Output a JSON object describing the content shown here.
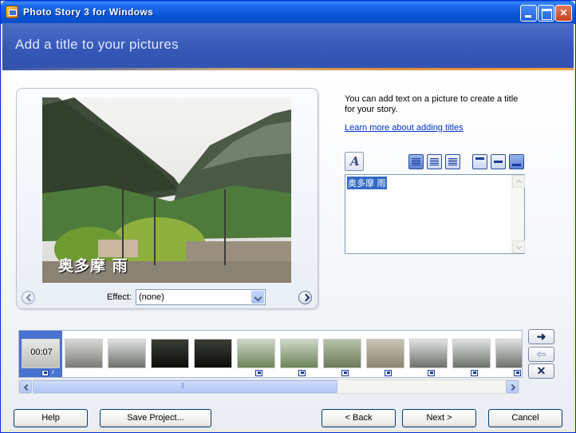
{
  "window": {
    "title": "Photo Story 3 for Windows"
  },
  "header": {
    "title": "Add a title to your pictures"
  },
  "preview": {
    "caption": "奥多摩 雨",
    "effect_label": "Effect:",
    "effect_value": "(none)"
  },
  "side": {
    "help_text": "You can add text on a picture to create a title for your story.",
    "learn_link": "Learn more about adding titles",
    "title_text": "奥多摩 雨"
  },
  "filmstrip": {
    "selected_time": "00:07",
    "thumbs": [
      {
        "tone": "selected"
      },
      {
        "tone": "gray"
      },
      {
        "tone": "mist"
      },
      {
        "tone": "dark"
      },
      {
        "tone": "dark"
      },
      {
        "tone": "green"
      },
      {
        "tone": "green"
      },
      {
        "tone": "flower"
      },
      {
        "tone": "grass"
      },
      {
        "tone": "mist"
      },
      {
        "tone": "mist"
      },
      {
        "tone": "mist"
      }
    ],
    "move_right": "➜",
    "move_left": "⇦",
    "delete": "✕"
  },
  "buttons": {
    "help": "Help",
    "save": "Save Project...",
    "back": "< Back",
    "next": "Next >",
    "cancel": "Cancel"
  },
  "colors": {
    "header_bg": "#3557b6",
    "accent": "#e08c38",
    "link": "#0033cc"
  }
}
